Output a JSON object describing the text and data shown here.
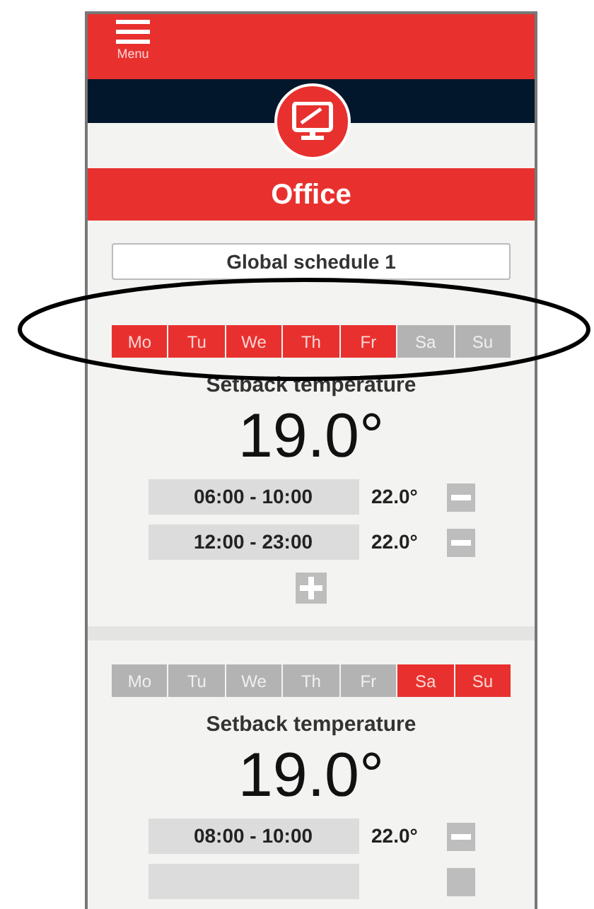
{
  "header": {
    "menu_label": "Menu"
  },
  "room": {
    "name": "Office"
  },
  "schedule": {
    "name": "Global schedule 1"
  },
  "programs": [
    {
      "days": [
        {
          "label": "Mo",
          "selected": true
        },
        {
          "label": "Tu",
          "selected": true
        },
        {
          "label": "We",
          "selected": true
        },
        {
          "label": "Th",
          "selected": true
        },
        {
          "label": "Fr",
          "selected": true
        },
        {
          "label": "Sa",
          "selected": false
        },
        {
          "label": "Su",
          "selected": false
        }
      ],
      "setback_label": "Setback temperature",
      "setback_value": "19.0°",
      "periods": [
        {
          "time": "06:00 - 10:00",
          "temperature": "22.0°"
        },
        {
          "time": "12:00 - 23:00",
          "temperature": "22.0°"
        }
      ],
      "add_button": true
    },
    {
      "days": [
        {
          "label": "Mo",
          "selected": false
        },
        {
          "label": "Tu",
          "selected": false
        },
        {
          "label": "We",
          "selected": false
        },
        {
          "label": "Th",
          "selected": false
        },
        {
          "label": "Fr",
          "selected": false
        },
        {
          "label": "Sa",
          "selected": true
        },
        {
          "label": "Su",
          "selected": true
        }
      ],
      "setback_label": "Setback temperature",
      "setback_value": "19.0°",
      "periods": [
        {
          "time": "08:00 - 10:00",
          "temperature": "22.0°"
        }
      ]
    }
  ]
}
